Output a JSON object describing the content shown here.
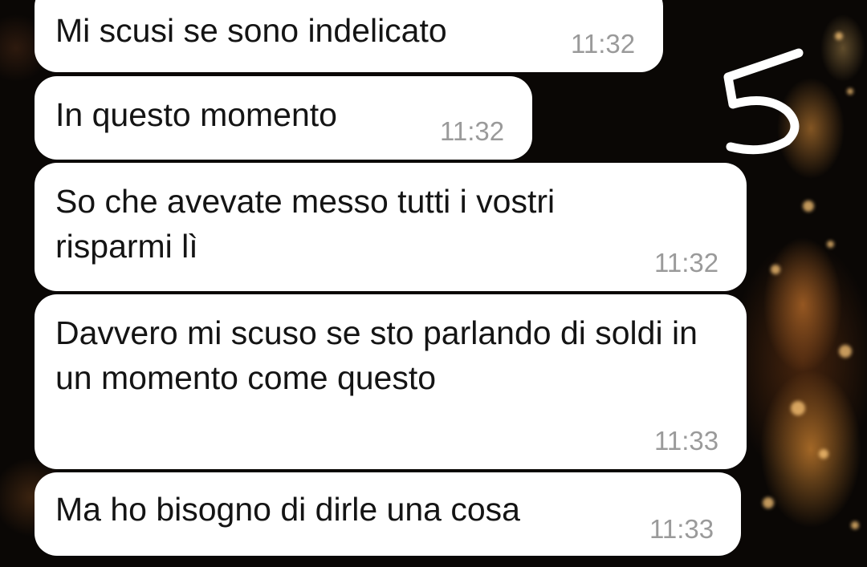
{
  "messages": [
    {
      "text": "Mi scusi se sono indelicato",
      "time": "11:32"
    },
    {
      "text": "In questo momento",
      "time": "11:32"
    },
    {
      "text": "So che avevate messo tutti i vostri risparmi lì",
      "time": "11:32"
    },
    {
      "text": "Davvero mi scuso se sto parlando di soldi in un momento come questo",
      "time": "11:33"
    },
    {
      "text": "Ma ho bisogno di dirle una cosa",
      "time": "11:33"
    }
  ],
  "annotation": {
    "number": "5"
  },
  "colors": {
    "bubble": "#ffffff",
    "text": "#141414",
    "time": "#9a9a9a",
    "background": "#0a0705"
  }
}
